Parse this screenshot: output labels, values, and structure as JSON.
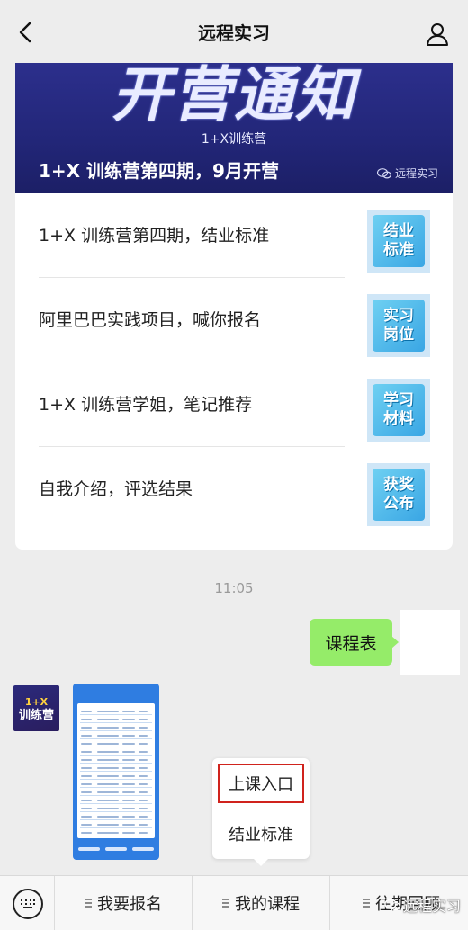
{
  "nav": {
    "title": "远程实习"
  },
  "article": {
    "banner": {
      "big_text": "开营通知",
      "sub_text": "1+X训练营",
      "headline": "1+X 训练营第四期，9月开营",
      "watermark": "远程实习"
    },
    "items": [
      {
        "title": "1+X 训练营第四期，结业标准",
        "thumb": "结业标准"
      },
      {
        "title": "阿里巴巴实践项目，喊你报名",
        "thumb": "实习岗位"
      },
      {
        "title": "1+X 训练营学姐，笔记推荐",
        "thumb": "学习材料"
      },
      {
        "title": "自我介绍，评选结果",
        "thumb": "获奖公布"
      }
    ]
  },
  "chat": {
    "timestamp": "11:05",
    "outgoing_text": "课程表",
    "incoming_avatar": {
      "line1": "1+X",
      "line2": "训练营"
    }
  },
  "popup": {
    "items": [
      "上课入口",
      "结业标准"
    ]
  },
  "menu": {
    "buttons": [
      "我要报名",
      "我的课程",
      "往期回顾"
    ],
    "watermark": "远程实习"
  },
  "colors": {
    "background": "#ededed",
    "outgoing_bubble": "#95ec69",
    "banner": "#222678",
    "highlight": "#d0231d"
  }
}
